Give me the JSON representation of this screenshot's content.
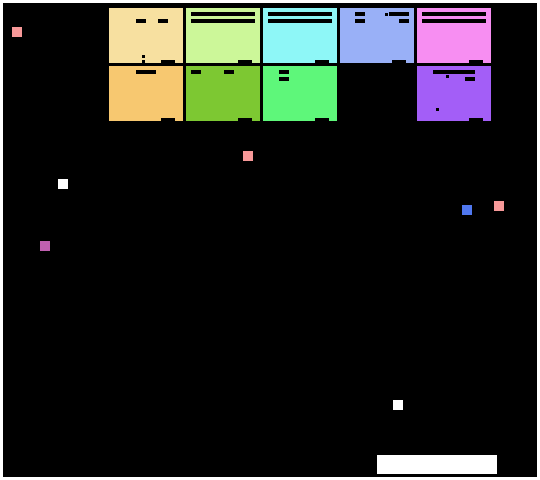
{
  "game": {
    "background_color": "#000000",
    "frame_color": "#ffffff",
    "paddle_color": "#ffffff"
  },
  "bricks": {
    "row1": [
      {
        "name": "brick-r1-c1",
        "color": "#f7e0a0"
      },
      {
        "name": "brick-r1-c2",
        "color": "#ccf799"
      },
      {
        "name": "brick-r1-c3",
        "color": "#8ef7f7"
      },
      {
        "name": "brick-r1-c4",
        "color": "#99b0f7"
      },
      {
        "name": "brick-r1-c5",
        "color": "#f78ef2"
      }
    ],
    "row2": [
      {
        "name": "brick-r2-c1",
        "color": "#f7c870"
      },
      {
        "name": "brick-r2-c2",
        "color": "#7dc832"
      },
      {
        "name": "brick-r2-c3",
        "color": "#5ef77a"
      },
      {
        "name": "brick-r2-c5",
        "color": "#a35ef7"
      }
    ]
  },
  "particles": [
    {
      "name": "particle-1",
      "color": "#f79999"
    },
    {
      "name": "particle-2",
      "color": "#f79999"
    },
    {
      "name": "particle-3",
      "color": "#ffffff"
    },
    {
      "name": "particle-4",
      "color": "#c060b0"
    },
    {
      "name": "particle-5",
      "color": "#5078f0"
    },
    {
      "name": "particle-6",
      "color": "#f79999"
    },
    {
      "name": "ball",
      "color": "#ffffff"
    }
  ]
}
